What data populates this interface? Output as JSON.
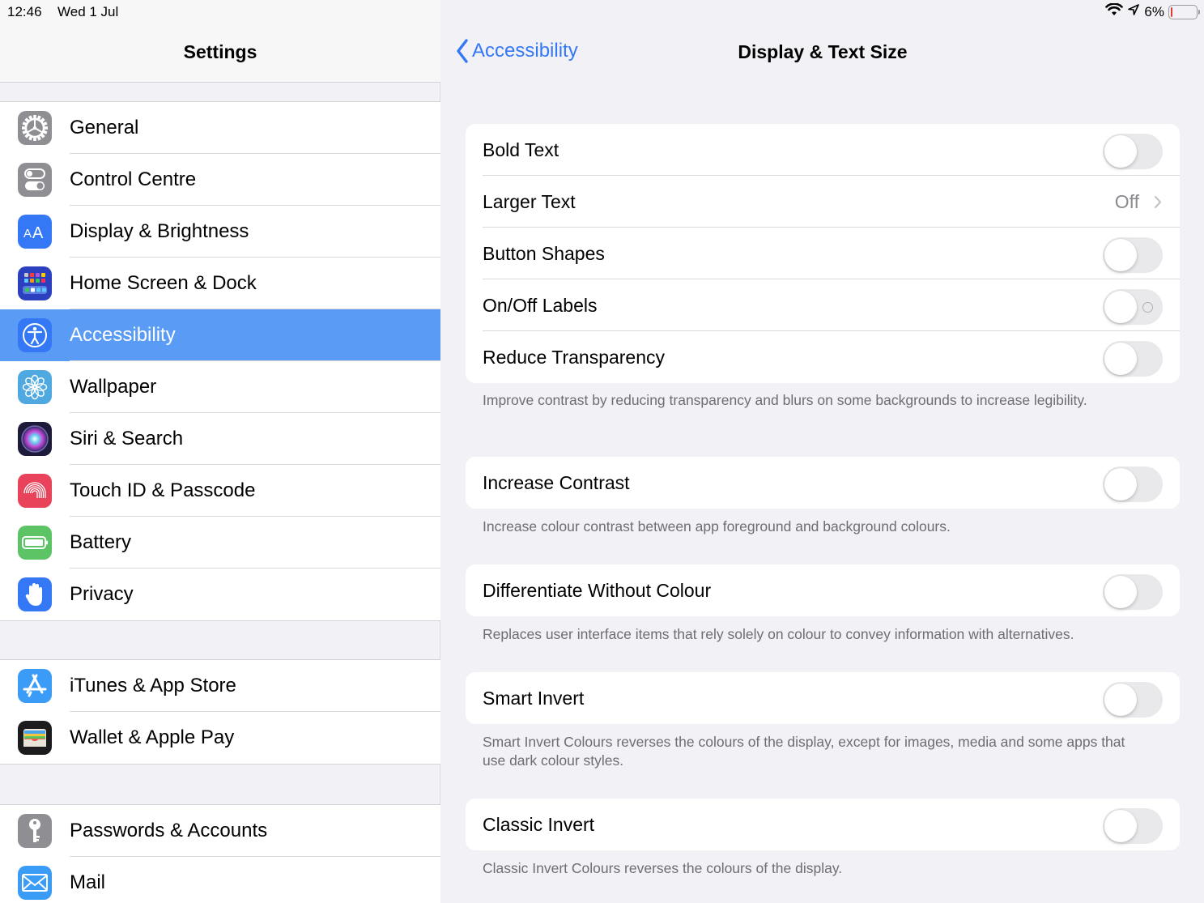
{
  "status_bar": {
    "time": "12:46",
    "date": "Wed 1 Jul",
    "battery_percent": "6%",
    "battery_level": 0.06,
    "icons": [
      "wifi-icon",
      "location-arrow-icon",
      "battery-icon"
    ]
  },
  "sidebar": {
    "title": "Settings",
    "groups": [
      {
        "items": [
          {
            "label": "General",
            "icon": "gear-icon",
            "color": "#8e8e93"
          },
          {
            "label": "Control Centre",
            "icon": "toggles-icon",
            "color": "#8e8e93"
          },
          {
            "label": "Display & Brightness",
            "icon": "text-size-icon",
            "color": "#3478f6"
          },
          {
            "label": "Home Screen & Dock",
            "icon": "app-grid-icon",
            "color": "#2c3fbf"
          },
          {
            "label": "Accessibility",
            "icon": "accessibility-icon",
            "color": "#3478f6",
            "selected": true
          },
          {
            "label": "Wallpaper",
            "icon": "flower-icon",
            "color": "#4fa9e0"
          },
          {
            "label": "Siri & Search",
            "icon": "siri-icon",
            "color": "#1e1b3a"
          },
          {
            "label": "Touch ID & Passcode",
            "icon": "fingerprint-icon",
            "color": "#e8435a"
          },
          {
            "label": "Battery",
            "icon": "battery-icon",
            "color": "#5dc466"
          },
          {
            "label": "Privacy",
            "icon": "hand-icon",
            "color": "#3478f6"
          }
        ]
      },
      {
        "items": [
          {
            "label": "iTunes & App Store",
            "icon": "app-store-icon",
            "color": "#3a9cf7"
          },
          {
            "label": "Wallet & Apple Pay",
            "icon": "wallet-icon",
            "color": "#1c1c1e"
          }
        ]
      },
      {
        "items": [
          {
            "label": "Passwords & Accounts",
            "icon": "key-icon",
            "color": "#8e8e93"
          },
          {
            "label": "Mail",
            "icon": "mail-icon",
            "color": "#3a9cf7"
          }
        ]
      }
    ]
  },
  "detail": {
    "back_label": "Accessibility",
    "title": "Display & Text Size",
    "sections": [
      {
        "rows": [
          {
            "label": "Bold Text",
            "type": "toggle",
            "on": false
          },
          {
            "label": "Larger Text",
            "type": "link",
            "value": "Off"
          },
          {
            "label": "Button Shapes",
            "type": "toggle",
            "on": false
          },
          {
            "label": "On/Off Labels",
            "type": "toggle",
            "on": false,
            "show_label_mark": true
          },
          {
            "label": "Reduce Transparency",
            "type": "toggle",
            "on": false
          }
        ],
        "footer": "Improve contrast by reducing transparency and blurs on some backgrounds to increase legibility."
      },
      {
        "rows": [
          {
            "label": "Increase Contrast",
            "type": "toggle",
            "on": false
          }
        ],
        "footer": "Increase colour contrast between app foreground and background colours."
      },
      {
        "rows": [
          {
            "label": "Differentiate Without Colour",
            "type": "toggle",
            "on": false
          }
        ],
        "footer": "Replaces user interface items that rely solely on colour to convey information with alternatives."
      },
      {
        "rows": [
          {
            "label": "Smart Invert",
            "type": "toggle",
            "on": false
          }
        ],
        "footer": "Smart Invert Colours reverses the colours of the display, except for images, media and some apps that use dark colour styles."
      },
      {
        "rows": [
          {
            "label": "Classic Invert",
            "type": "toggle",
            "on": false
          }
        ],
        "footer": "Classic Invert Colours reverses the colours of the display."
      }
    ]
  },
  "colors": {
    "accent": "#3478f6",
    "selected_row": "#5a9cf5",
    "background": "#f2f1f6",
    "toggle_off": "#e9e9eb"
  }
}
